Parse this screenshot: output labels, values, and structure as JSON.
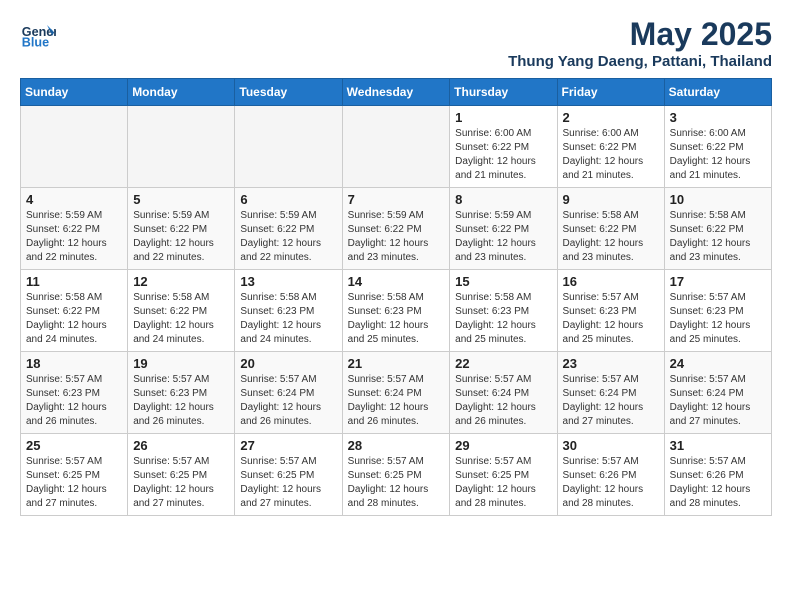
{
  "header": {
    "logo_line1": "General",
    "logo_line2": "Blue",
    "month": "May 2025",
    "location": "Thung Yang Daeng, Pattani, Thailand"
  },
  "weekdays": [
    "Sunday",
    "Monday",
    "Tuesday",
    "Wednesday",
    "Thursday",
    "Friday",
    "Saturday"
  ],
  "weeks": [
    [
      {
        "day": "",
        "info": ""
      },
      {
        "day": "",
        "info": ""
      },
      {
        "day": "",
        "info": ""
      },
      {
        "day": "",
        "info": ""
      },
      {
        "day": "1",
        "info": "Sunrise: 6:00 AM\nSunset: 6:22 PM\nDaylight: 12 hours\nand 21 minutes."
      },
      {
        "day": "2",
        "info": "Sunrise: 6:00 AM\nSunset: 6:22 PM\nDaylight: 12 hours\nand 21 minutes."
      },
      {
        "day": "3",
        "info": "Sunrise: 6:00 AM\nSunset: 6:22 PM\nDaylight: 12 hours\nand 21 minutes."
      }
    ],
    [
      {
        "day": "4",
        "info": "Sunrise: 5:59 AM\nSunset: 6:22 PM\nDaylight: 12 hours\nand 22 minutes."
      },
      {
        "day": "5",
        "info": "Sunrise: 5:59 AM\nSunset: 6:22 PM\nDaylight: 12 hours\nand 22 minutes."
      },
      {
        "day": "6",
        "info": "Sunrise: 5:59 AM\nSunset: 6:22 PM\nDaylight: 12 hours\nand 22 minutes."
      },
      {
        "day": "7",
        "info": "Sunrise: 5:59 AM\nSunset: 6:22 PM\nDaylight: 12 hours\nand 23 minutes."
      },
      {
        "day": "8",
        "info": "Sunrise: 5:59 AM\nSunset: 6:22 PM\nDaylight: 12 hours\nand 23 minutes."
      },
      {
        "day": "9",
        "info": "Sunrise: 5:58 AM\nSunset: 6:22 PM\nDaylight: 12 hours\nand 23 minutes."
      },
      {
        "day": "10",
        "info": "Sunrise: 5:58 AM\nSunset: 6:22 PM\nDaylight: 12 hours\nand 23 minutes."
      }
    ],
    [
      {
        "day": "11",
        "info": "Sunrise: 5:58 AM\nSunset: 6:22 PM\nDaylight: 12 hours\nand 24 minutes."
      },
      {
        "day": "12",
        "info": "Sunrise: 5:58 AM\nSunset: 6:22 PM\nDaylight: 12 hours\nand 24 minutes."
      },
      {
        "day": "13",
        "info": "Sunrise: 5:58 AM\nSunset: 6:23 PM\nDaylight: 12 hours\nand 24 minutes."
      },
      {
        "day": "14",
        "info": "Sunrise: 5:58 AM\nSunset: 6:23 PM\nDaylight: 12 hours\nand 25 minutes."
      },
      {
        "day": "15",
        "info": "Sunrise: 5:58 AM\nSunset: 6:23 PM\nDaylight: 12 hours\nand 25 minutes."
      },
      {
        "day": "16",
        "info": "Sunrise: 5:57 AM\nSunset: 6:23 PM\nDaylight: 12 hours\nand 25 minutes."
      },
      {
        "day": "17",
        "info": "Sunrise: 5:57 AM\nSunset: 6:23 PM\nDaylight: 12 hours\nand 25 minutes."
      }
    ],
    [
      {
        "day": "18",
        "info": "Sunrise: 5:57 AM\nSunset: 6:23 PM\nDaylight: 12 hours\nand 26 minutes."
      },
      {
        "day": "19",
        "info": "Sunrise: 5:57 AM\nSunset: 6:23 PM\nDaylight: 12 hours\nand 26 minutes."
      },
      {
        "day": "20",
        "info": "Sunrise: 5:57 AM\nSunset: 6:24 PM\nDaylight: 12 hours\nand 26 minutes."
      },
      {
        "day": "21",
        "info": "Sunrise: 5:57 AM\nSunset: 6:24 PM\nDaylight: 12 hours\nand 26 minutes."
      },
      {
        "day": "22",
        "info": "Sunrise: 5:57 AM\nSunset: 6:24 PM\nDaylight: 12 hours\nand 26 minutes."
      },
      {
        "day": "23",
        "info": "Sunrise: 5:57 AM\nSunset: 6:24 PM\nDaylight: 12 hours\nand 27 minutes."
      },
      {
        "day": "24",
        "info": "Sunrise: 5:57 AM\nSunset: 6:24 PM\nDaylight: 12 hours\nand 27 minutes."
      }
    ],
    [
      {
        "day": "25",
        "info": "Sunrise: 5:57 AM\nSunset: 6:25 PM\nDaylight: 12 hours\nand 27 minutes."
      },
      {
        "day": "26",
        "info": "Sunrise: 5:57 AM\nSunset: 6:25 PM\nDaylight: 12 hours\nand 27 minutes."
      },
      {
        "day": "27",
        "info": "Sunrise: 5:57 AM\nSunset: 6:25 PM\nDaylight: 12 hours\nand 27 minutes."
      },
      {
        "day": "28",
        "info": "Sunrise: 5:57 AM\nSunset: 6:25 PM\nDaylight: 12 hours\nand 28 minutes."
      },
      {
        "day": "29",
        "info": "Sunrise: 5:57 AM\nSunset: 6:25 PM\nDaylight: 12 hours\nand 28 minutes."
      },
      {
        "day": "30",
        "info": "Sunrise: 5:57 AM\nSunset: 6:26 PM\nDaylight: 12 hours\nand 28 minutes."
      },
      {
        "day": "31",
        "info": "Sunrise: 5:57 AM\nSunset: 6:26 PM\nDaylight: 12 hours\nand 28 minutes."
      }
    ]
  ]
}
